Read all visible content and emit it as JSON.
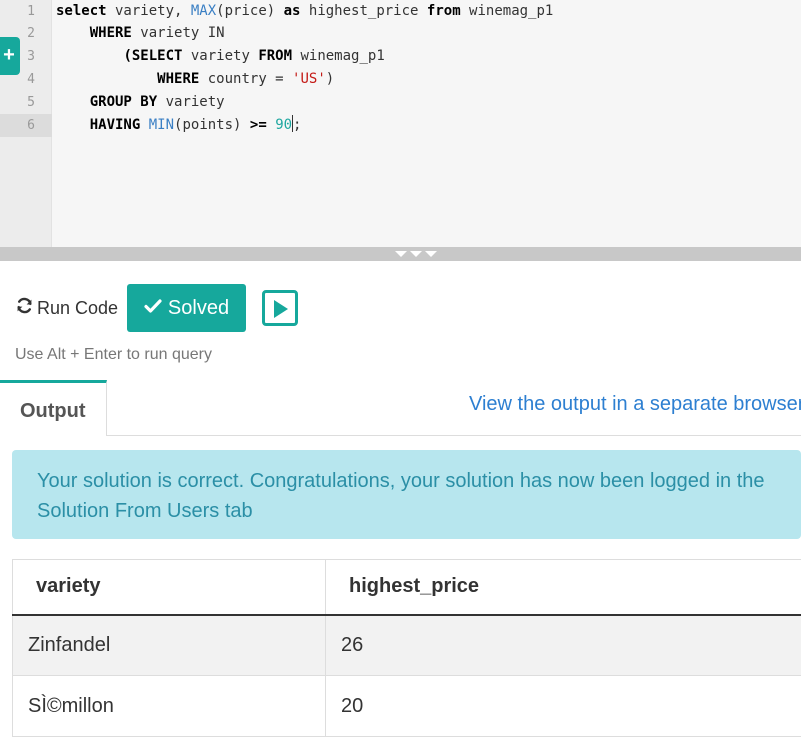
{
  "editor": {
    "line_numbers": [
      "1",
      "2",
      "3",
      "4",
      "5",
      "6"
    ],
    "side_tab_label": "+",
    "lines": [
      {
        "t1": "select",
        "t2": " variety, ",
        "t3": "MAX",
        "t4": "(price) ",
        "t5": "as",
        "t6": " highest_price ",
        "t7": "from",
        "t8": " winemag_p1"
      },
      {
        "indent": "    ",
        "t1": "WHERE",
        "t2": " variety IN"
      },
      {
        "indent": "        ",
        "t1": "(SELECT",
        "t2": " variety ",
        "t3": "FROM",
        "t4": " winemag_p1"
      },
      {
        "indent": "            ",
        "t1": "WHERE",
        "t2": " country = ",
        "t3": "'US'",
        "t4": ")"
      },
      {
        "indent": "    ",
        "t1": "GROUP BY",
        "t2": " variety"
      },
      {
        "indent": "    ",
        "t1": "HAVING",
        "t2": " ",
        "t3": "MIN",
        "t4": "(points) ",
        "t5": ">=",
        "t6": " ",
        "t7": "90",
        "t8": ";"
      }
    ]
  },
  "controls": {
    "run_code_label": "Run Code",
    "solved_label": "Solved",
    "hint": "Use Alt + Enter to run query"
  },
  "tabs": {
    "output_label": "Output",
    "view_link": "View the output in a separate browser tab"
  },
  "alert": {
    "message": "Your solution is correct. Congratulations, your solution has now been logged in the Solution From Users tab"
  },
  "result_table": {
    "headers": [
      "variety",
      "highest_price"
    ],
    "rows": [
      [
        "Zinfandel",
        "26"
      ],
      [
        "SÌ©millon",
        "20"
      ]
    ]
  },
  "colors": {
    "accent": "#16a89c",
    "link": "#2d7fd1",
    "alert_bg": "#b7e6ee",
    "alert_text": "#2b8fa6"
  }
}
